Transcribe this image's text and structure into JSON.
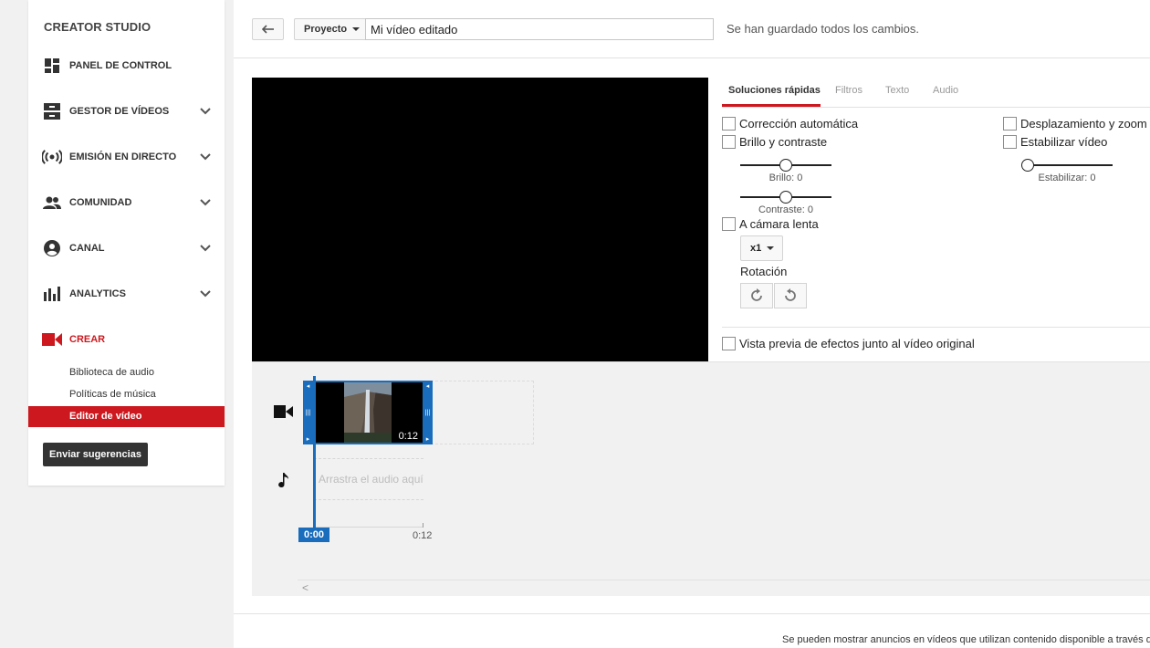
{
  "sidebar": {
    "brand": "CREATOR STUDIO",
    "items": [
      {
        "label": "PANEL DE CONTROL"
      },
      {
        "label": "GESTOR DE VÍDEOS"
      },
      {
        "label": "EMISIÓN EN DIRECTO"
      },
      {
        "label": "COMUNIDAD"
      },
      {
        "label": "CANAL"
      },
      {
        "label": "ANALYTICS"
      },
      {
        "label": "CREAR"
      }
    ],
    "subitems": [
      {
        "label": "Biblioteca de audio"
      },
      {
        "label": "Políticas de música"
      },
      {
        "label": "Editor de vídeo"
      }
    ],
    "feedback_label": "Enviar sugerencias",
    "accent": "#cc181e"
  },
  "topbar": {
    "project_label": "Proyecto",
    "title_value": "Mi vídeo editado",
    "save_status": "Se han guardado todos los cambios."
  },
  "tabs": [
    {
      "label": "Soluciones rápidas"
    },
    {
      "label": "Filtros"
    },
    {
      "label": "Texto"
    },
    {
      "label": "Audio"
    }
  ],
  "quickfix": {
    "auto_correct": "Corrección automática",
    "brightness_contrast": "Brillo y contraste",
    "brightness_label": "Brillo: 0",
    "contrast_label": "Contraste: 0",
    "pan_zoom": "Desplazamiento y zoom",
    "stabilize": "Estabilizar vídeo",
    "stabilize_label": "Estabilizar: 0",
    "slow_motion": "A cámara lenta",
    "speed_value": "x1",
    "rotation_label": "Rotación",
    "preview_effects": "Vista previa de efectos junto al vídeo original",
    "brightness_value": 0.5,
    "contrast_value": 0.5,
    "stabilize_value": 0.0
  },
  "timeline": {
    "clip_duration": "0:12",
    "audio_placeholder": "Arrastra el audio aquí",
    "current_time": "0:00",
    "end_time": "0:12",
    "clip_color": "#1a6dbd"
  },
  "footer": {
    "note": "Se pueden mostrar anuncios en vídeos que utilizan contenido disponible a través d"
  }
}
